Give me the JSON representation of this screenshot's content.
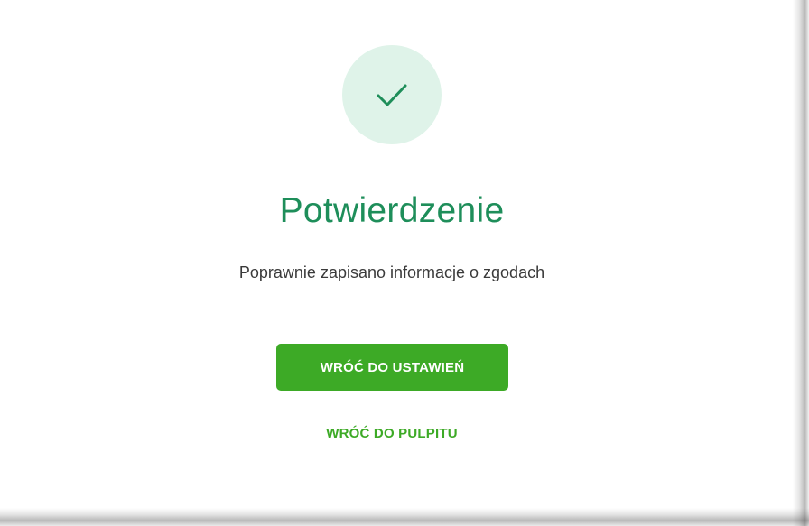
{
  "confirmation": {
    "icon": "check-icon",
    "title": "Potwierdzenie",
    "message": "Poprawnie zapisano informacje o zgodach",
    "primary_button_label": "WRÓĆ DO USTAWIEŃ",
    "secondary_link_label": "WRÓĆ DO PULPITU"
  },
  "colors": {
    "accent_green": "#3daa26",
    "title_green": "#1e8e5a",
    "icon_circle_bg": "#dff3e9",
    "check_stroke": "#1e8e5a"
  }
}
